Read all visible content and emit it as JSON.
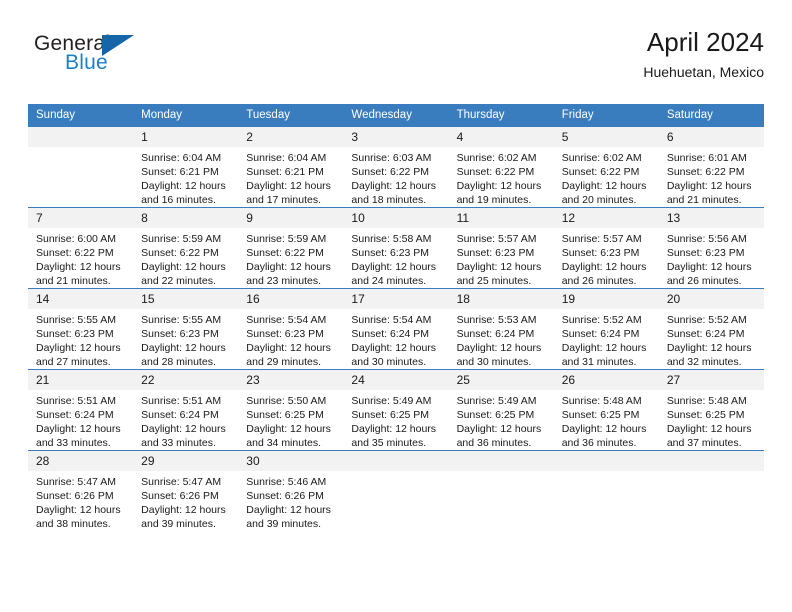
{
  "brand": {
    "line1": "General",
    "line2": "Blue",
    "triangle_icon": "triangle-logo-icon",
    "color_dark": "#231f20",
    "color_blue": "#1f7fc4",
    "color_triangle": "#1565a8"
  },
  "header": {
    "title": "April 2024",
    "subtitle": "Huehuetan, Mexico"
  },
  "theme": {
    "header_row_bg": "#3a7dbf",
    "daynum_bg": "#f2f2f2",
    "text": "#1a1a1a"
  },
  "calendar": {
    "weekday_headers": [
      "Sunday",
      "Monday",
      "Tuesday",
      "Wednesday",
      "Thursday",
      "Friday",
      "Saturday"
    ],
    "weeks": [
      [
        {
          "day": "",
          "sunrise": "",
          "sunset": "",
          "daylight": ""
        },
        {
          "day": "1",
          "sunrise": "Sunrise: 6:04 AM",
          "sunset": "Sunset: 6:21 PM",
          "daylight": "Daylight: 12 hours and 16 minutes."
        },
        {
          "day": "2",
          "sunrise": "Sunrise: 6:04 AM",
          "sunset": "Sunset: 6:21 PM",
          "daylight": "Daylight: 12 hours and 17 minutes."
        },
        {
          "day": "3",
          "sunrise": "Sunrise: 6:03 AM",
          "sunset": "Sunset: 6:22 PM",
          "daylight": "Daylight: 12 hours and 18 minutes."
        },
        {
          "day": "4",
          "sunrise": "Sunrise: 6:02 AM",
          "sunset": "Sunset: 6:22 PM",
          "daylight": "Daylight: 12 hours and 19 minutes."
        },
        {
          "day": "5",
          "sunrise": "Sunrise: 6:02 AM",
          "sunset": "Sunset: 6:22 PM",
          "daylight": "Daylight: 12 hours and 20 minutes."
        },
        {
          "day": "6",
          "sunrise": "Sunrise: 6:01 AM",
          "sunset": "Sunset: 6:22 PM",
          "daylight": "Daylight: 12 hours and 21 minutes."
        }
      ],
      [
        {
          "day": "7",
          "sunrise": "Sunrise: 6:00 AM",
          "sunset": "Sunset: 6:22 PM",
          "daylight": "Daylight: 12 hours and 21 minutes."
        },
        {
          "day": "8",
          "sunrise": "Sunrise: 5:59 AM",
          "sunset": "Sunset: 6:22 PM",
          "daylight": "Daylight: 12 hours and 22 minutes."
        },
        {
          "day": "9",
          "sunrise": "Sunrise: 5:59 AM",
          "sunset": "Sunset: 6:22 PM",
          "daylight": "Daylight: 12 hours and 23 minutes."
        },
        {
          "day": "10",
          "sunrise": "Sunrise: 5:58 AM",
          "sunset": "Sunset: 6:23 PM",
          "daylight": "Daylight: 12 hours and 24 minutes."
        },
        {
          "day": "11",
          "sunrise": "Sunrise: 5:57 AM",
          "sunset": "Sunset: 6:23 PM",
          "daylight": "Daylight: 12 hours and 25 minutes."
        },
        {
          "day": "12",
          "sunrise": "Sunrise: 5:57 AM",
          "sunset": "Sunset: 6:23 PM",
          "daylight": "Daylight: 12 hours and 26 minutes."
        },
        {
          "day": "13",
          "sunrise": "Sunrise: 5:56 AM",
          "sunset": "Sunset: 6:23 PM",
          "daylight": "Daylight: 12 hours and 26 minutes."
        }
      ],
      [
        {
          "day": "14",
          "sunrise": "Sunrise: 5:55 AM",
          "sunset": "Sunset: 6:23 PM",
          "daylight": "Daylight: 12 hours and 27 minutes."
        },
        {
          "day": "15",
          "sunrise": "Sunrise: 5:55 AM",
          "sunset": "Sunset: 6:23 PM",
          "daylight": "Daylight: 12 hours and 28 minutes."
        },
        {
          "day": "16",
          "sunrise": "Sunrise: 5:54 AM",
          "sunset": "Sunset: 6:23 PM",
          "daylight": "Daylight: 12 hours and 29 minutes."
        },
        {
          "day": "17",
          "sunrise": "Sunrise: 5:54 AM",
          "sunset": "Sunset: 6:24 PM",
          "daylight": "Daylight: 12 hours and 30 minutes."
        },
        {
          "day": "18",
          "sunrise": "Sunrise: 5:53 AM",
          "sunset": "Sunset: 6:24 PM",
          "daylight": "Daylight: 12 hours and 30 minutes."
        },
        {
          "day": "19",
          "sunrise": "Sunrise: 5:52 AM",
          "sunset": "Sunset: 6:24 PM",
          "daylight": "Daylight: 12 hours and 31 minutes."
        },
        {
          "day": "20",
          "sunrise": "Sunrise: 5:52 AM",
          "sunset": "Sunset: 6:24 PM",
          "daylight": "Daylight: 12 hours and 32 minutes."
        }
      ],
      [
        {
          "day": "21",
          "sunrise": "Sunrise: 5:51 AM",
          "sunset": "Sunset: 6:24 PM",
          "daylight": "Daylight: 12 hours and 33 minutes."
        },
        {
          "day": "22",
          "sunrise": "Sunrise: 5:51 AM",
          "sunset": "Sunset: 6:24 PM",
          "daylight": "Daylight: 12 hours and 33 minutes."
        },
        {
          "day": "23",
          "sunrise": "Sunrise: 5:50 AM",
          "sunset": "Sunset: 6:25 PM",
          "daylight": "Daylight: 12 hours and 34 minutes."
        },
        {
          "day": "24",
          "sunrise": "Sunrise: 5:49 AM",
          "sunset": "Sunset: 6:25 PM",
          "daylight": "Daylight: 12 hours and 35 minutes."
        },
        {
          "day": "25",
          "sunrise": "Sunrise: 5:49 AM",
          "sunset": "Sunset: 6:25 PM",
          "daylight": "Daylight: 12 hours and 36 minutes."
        },
        {
          "day": "26",
          "sunrise": "Sunrise: 5:48 AM",
          "sunset": "Sunset: 6:25 PM",
          "daylight": "Daylight: 12 hours and 36 minutes."
        },
        {
          "day": "27",
          "sunrise": "Sunrise: 5:48 AM",
          "sunset": "Sunset: 6:25 PM",
          "daylight": "Daylight: 12 hours and 37 minutes."
        }
      ],
      [
        {
          "day": "28",
          "sunrise": "Sunrise: 5:47 AM",
          "sunset": "Sunset: 6:26 PM",
          "daylight": "Daylight: 12 hours and 38 minutes."
        },
        {
          "day": "29",
          "sunrise": "Sunrise: 5:47 AM",
          "sunset": "Sunset: 6:26 PM",
          "daylight": "Daylight: 12 hours and 39 minutes."
        },
        {
          "day": "30",
          "sunrise": "Sunrise: 5:46 AM",
          "sunset": "Sunset: 6:26 PM",
          "daylight": "Daylight: 12 hours and 39 minutes."
        },
        {
          "day": "",
          "sunrise": "",
          "sunset": "",
          "daylight": ""
        },
        {
          "day": "",
          "sunrise": "",
          "sunset": "",
          "daylight": ""
        },
        {
          "day": "",
          "sunrise": "",
          "sunset": "",
          "daylight": ""
        },
        {
          "day": "",
          "sunrise": "",
          "sunset": "",
          "daylight": ""
        }
      ]
    ]
  }
}
